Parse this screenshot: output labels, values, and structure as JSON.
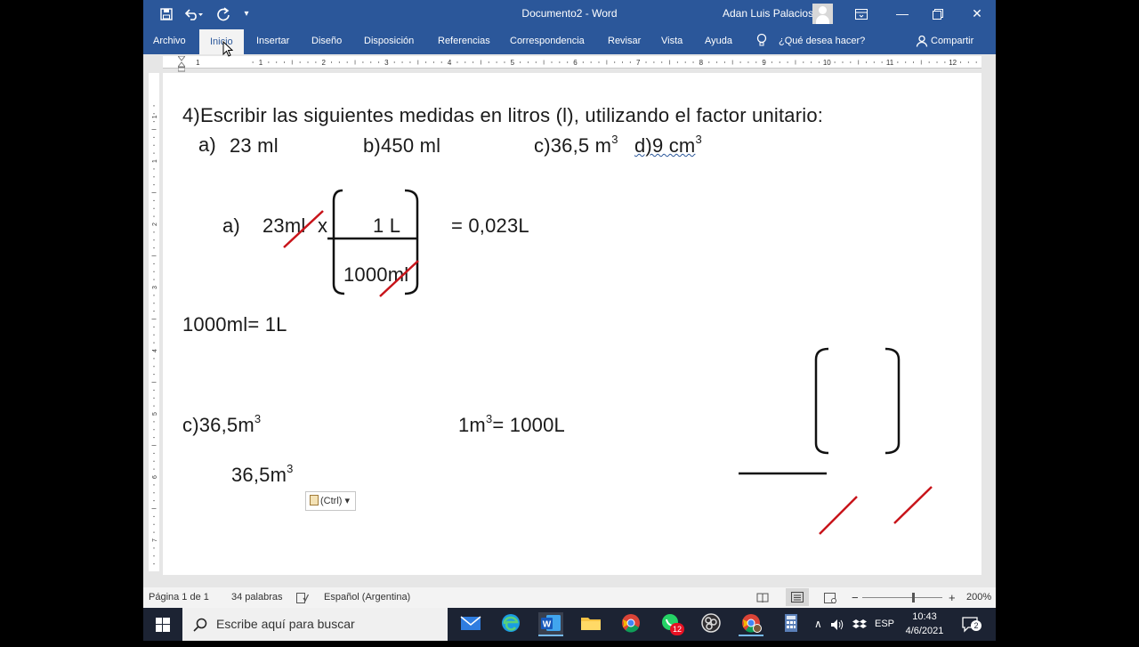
{
  "titlebar": {
    "doc_title": "Documento2  -  Word",
    "user_name": "Adan Luis Palacios",
    "quick_access": [
      "save-icon",
      "undo-icon",
      "redo-icon",
      "customize-icon"
    ],
    "window_controls": [
      "ribbon-display-icon",
      "minimize-icon",
      "restore-icon",
      "close-icon"
    ]
  },
  "ribbon": {
    "tabs": [
      "Archivo",
      "Inicio",
      "Insertar",
      "Diseño",
      "Disposición",
      "Referencias",
      "Correspondencia",
      "Revisar",
      "Vista",
      "Ayuda"
    ],
    "active_tab": "Inicio",
    "tell_me": "¿Qué desea hacer?",
    "share": "Compartir"
  },
  "ruler": {
    "numbers": [
      "1",
      "1",
      "2",
      "3",
      "4",
      "5",
      "6",
      "7",
      "8",
      "9",
      "10",
      "11",
      "12"
    ],
    "v_numbers": [
      "1",
      "1",
      "2",
      "3",
      "4",
      "5",
      "6",
      "7"
    ]
  },
  "document": {
    "title_line": "4)Escribir las siguientes medidas en litros (l), utilizando el factor unitario:",
    "item_a": "a)",
    "item_a_val": "23 ml",
    "item_b": "b)450 ml",
    "item_c_pre": "c)36,5 m",
    "item_d_pre": "d)9 cm",
    "sup3": "3",
    "calc_label": "a)",
    "calc_value": "23ml",
    "calc_times": "x",
    "frac_num": "1  L",
    "frac_den": "1000ml",
    "calc_result": "= 0,023L",
    "equiv1": "1000ml= 1L",
    "c_line": "c)36,5m",
    "equiv2_pre": "1m",
    "equiv2_post": "= 1000L",
    "c_second": "36,5m",
    "paste_label": "(Ctrl)"
  },
  "status": {
    "page": "Página 1 de 1",
    "words": "34 palabras",
    "language": "Español (Argentina)",
    "zoom": "200%"
  },
  "taskbar": {
    "search_placeholder": "Escribe aquí para buscar",
    "apps": [
      "mail-icon",
      "edge-icon",
      "word-icon",
      "explorer-icon",
      "chrome-icon",
      "whatsapp-icon",
      "obs-icon",
      "chrome-profile-icon",
      "calculator-icon"
    ],
    "whatsapp_badge": "12",
    "lang": "ESP",
    "time": "10:43",
    "date": "4/6/2021",
    "notification_count": "2"
  },
  "colors": {
    "word_blue": "#2b579a",
    "ink_red": "#c8141a",
    "text": "#1a1a1a"
  }
}
